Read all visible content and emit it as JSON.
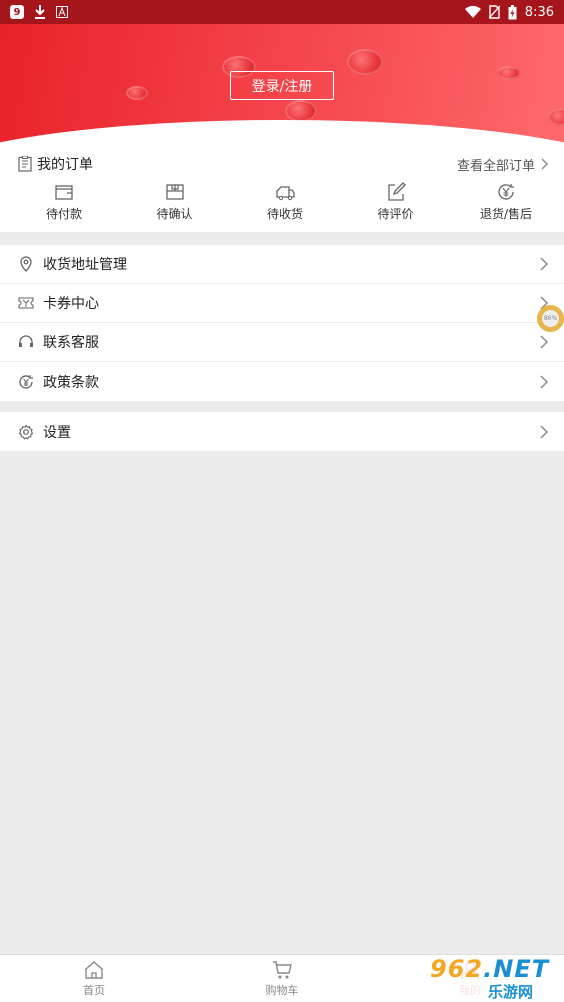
{
  "status_bar": {
    "time": "8:36",
    "app_icon_text": "9",
    "icons": [
      "app-9-icon",
      "download-icon",
      "a-icon",
      "wifi-icon",
      "no-sim-icon",
      "battery-icon"
    ]
  },
  "header": {
    "login_label": "登录/注册",
    "colors": {
      "start": "#e9222a",
      "end": "#ff6a6a"
    }
  },
  "orders": {
    "title": "我的订单",
    "view_all": "查看全部订单",
    "items": [
      {
        "label": "待付款",
        "icon": "wallet-icon"
      },
      {
        "label": "待确认",
        "icon": "package-icon"
      },
      {
        "label": "待收货",
        "icon": "truck-icon"
      },
      {
        "label": "待评价",
        "icon": "edit-icon"
      },
      {
        "label": "退货/售后",
        "icon": "refund-icon"
      }
    ]
  },
  "menu": {
    "group1": [
      {
        "label": "收货地址管理",
        "icon": "location-icon"
      },
      {
        "label": "卡券中心",
        "icon": "coupon-icon"
      },
      {
        "label": "联系客服",
        "icon": "headset-icon"
      },
      {
        "label": "政策条款",
        "icon": "policy-icon"
      }
    ],
    "group2": [
      {
        "label": "设置",
        "icon": "gear-icon"
      }
    ]
  },
  "float_badge": {
    "text": "86%"
  },
  "tabbar": {
    "items": [
      {
        "label": "首页",
        "icon": "home-icon"
      },
      {
        "label": "购物车",
        "icon": "cart-icon"
      },
      {
        "label": "我的",
        "icon": "user-icon"
      }
    ]
  },
  "watermark": {
    "brand_num": "962",
    "brand_tld": ".NET",
    "brand_cn": "乐游网"
  },
  "colors": {
    "accent": "#e4393c",
    "status_bar": "#a4151c"
  }
}
